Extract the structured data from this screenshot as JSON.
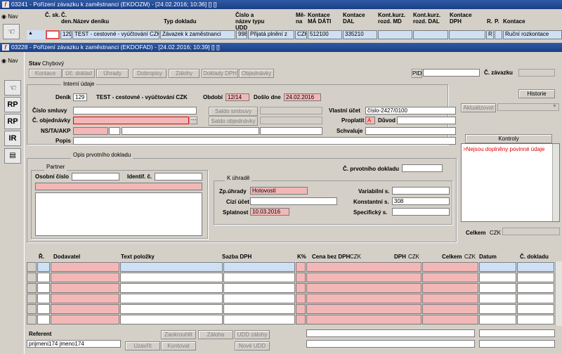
{
  "bg_window": {
    "title": "03241 - Pořízení závazku k zaměstnanci (EKDOZM) - [24.02.2016; 10:36] [] []",
    "nav_label": "Nav",
    "columns": [
      "Č. sk.",
      "Č. den.",
      "Název deníku",
      "Typ dokladu",
      "Číslo a název typu UDD",
      "Mě-na",
      "Kontace MÁ DÁTI",
      "Kontace DAL",
      "Kont.kurz. rozd. MD",
      "Kont.kurz. rozd. DAL",
      "Kontace DPH",
      "R.",
      "P.",
      "Kontace"
    ],
    "row": [
      "",
      "129",
      "TEST - cestovné - vyúčtování CZK",
      "Závazek k zaměstnanci",
      "998",
      "Přijatá plnění z",
      "CZK",
      "512100",
      "335210",
      "",
      "",
      "",
      "R",
      "Ruční rozkontace"
    ]
  },
  "window": {
    "title": "03228 - Pořízení závazku k zaměstnanci (EKDOFAD) - [24.02.2016; 10:39] [] []",
    "nav_label": "Nav",
    "stav_label": "Stav",
    "stav_value": "Chybový",
    "toolbar": [
      "Kontace",
      "Úč. doklad",
      "Úhrady",
      "Dobropisy",
      "Zálohy",
      "Doklady DPH",
      "Objednávky"
    ],
    "pid_label": "PID",
    "c_zavazku_label": "Č. závazku",
    "internal_title": "Interní údaje",
    "historie": "Historie",
    "denik_label": "Deník",
    "denik_num": "129",
    "denik_name": "TEST - cestovné - vyúčtování CZK",
    "obdobi_label": "Období",
    "obdobi_value": "12/14",
    "doslo_label": "Došlo dne",
    "doslo_value": "24.02.2016",
    "cislo_smlouvy": "Číslo smluvy",
    "c_objednavky": "Č. objednávky",
    "ns_label": "NS/TA/AKP",
    "popis_label": "Popis",
    "saldo_smlouvy": "Saldo smlouvy",
    "saldo_objednavky": "Saldo objednávky",
    "vlastni_ucet_label": "Vlastní účet",
    "vlastni_ucet_value": "číslo-2427/0100",
    "proplatit_label": "Proplatit",
    "proplatit_value": "A",
    "duvod_label": "Důvod",
    "schvaluje_label": "Schvaluje",
    "aktualizovat": "Aktualizovat",
    "kontroly_title": "Kontroly",
    "kontroly_msg": ">Nejsou doplněny povinné údaje",
    "opis_title": "Opis prvotního dokladu",
    "partner_title": "Partner",
    "osobni_cislo": "Osobní číslo",
    "identif": "Identif. č.",
    "c_prvotniho": "Č. prvotního dokladu",
    "k_uhrade_title": "K úhradě",
    "zp_uhrady_label": "Zp.úhrady",
    "zp_uhrady_value": "Hotovostí",
    "cizi_ucet_label": "Cizí účet",
    "splatnost_label": "Splatnost",
    "splatnost_value": "10.03.2016",
    "variabilni_label": "Variabilní s.",
    "konstantni_label": "Konstantní s.",
    "konstantni_value": "308",
    "specificky_label": "Specifický s.",
    "celkem_label": "Celkem",
    "celkem_currency": "CZK",
    "items_headers": [
      "Ř.",
      "Dodavatel",
      "Text položky",
      "Sazba DPH",
      "K%",
      "Cena bez DPH",
      "CZK",
      "DPH",
      "CZK",
      "Celkem",
      "CZK",
      "Datum",
      "Č. dokladu"
    ],
    "referent_label": "Referent",
    "referent_value": "prijmeni174 jmeno174",
    "bottom_buttons": [
      "Zaokrouhlit",
      "Záloha",
      "UDD zálohy",
      "Uzavřít",
      "Kontovat",
      "Nové UDD"
    ],
    "side_tools": [
      "RP",
      "RP",
      "IR"
    ]
  },
  "colors": {
    "title_bar": "#1b3f86",
    "required_field": "#f4b7b7",
    "selected_row": "#cfe0f4",
    "error_text": "#e00000"
  }
}
